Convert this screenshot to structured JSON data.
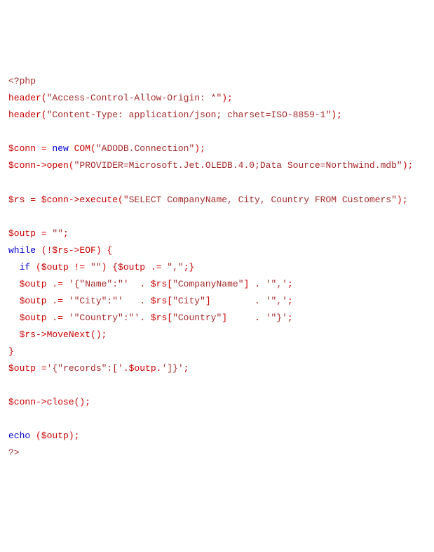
{
  "code": {
    "lines": [
      [
        {
          "text": "<?php",
          "cls": "brown"
        }
      ],
      [
        {
          "text": "header(",
          "cls": "red"
        },
        {
          "text": "\"Access-Control-Allow-Origin: *\"",
          "cls": "brown"
        },
        {
          "text": ");",
          "cls": "red"
        }
      ],
      [
        {
          "text": "header(",
          "cls": "red"
        },
        {
          "text": "\"Content-Type: application/json; charset=ISO-8859-1\"",
          "cls": "brown"
        },
        {
          "text": ");",
          "cls": "red"
        }
      ],
      [
        {
          "text": "",
          "cls": "black"
        }
      ],
      [
        {
          "text": "$conn = ",
          "cls": "red"
        },
        {
          "text": "new",
          "cls": "blue"
        },
        {
          "text": " COM(",
          "cls": "red"
        },
        {
          "text": "\"ADODB.Connection\"",
          "cls": "brown"
        },
        {
          "text": ");",
          "cls": "red"
        }
      ],
      [
        {
          "text": "$conn->open(",
          "cls": "red"
        },
        {
          "text": "\"PROVIDER=Microsoft.Jet.OLEDB.4.0;Data Source=Northwind.mdb\"",
          "cls": "brown"
        },
        {
          "text": ");",
          "cls": "red"
        }
      ],
      [
        {
          "text": "",
          "cls": "black"
        }
      ],
      [
        {
          "text": "$rs = $conn->execute(",
          "cls": "red"
        },
        {
          "text": "\"SELECT CompanyName, City, Country FROM Customers\"",
          "cls": "brown"
        },
        {
          "text": ");",
          "cls": "red"
        }
      ],
      [
        {
          "text": "",
          "cls": "black"
        }
      ],
      [
        {
          "text": "$outp = ",
          "cls": "red"
        },
        {
          "text": "\"\"",
          "cls": "brown"
        },
        {
          "text": ";",
          "cls": "red"
        }
      ],
      [
        {
          "text": "while",
          "cls": "blue"
        },
        {
          "text": " (!$rs->EOF) {",
          "cls": "red"
        }
      ],
      [
        {
          "text": "  ",
          "cls": "black"
        },
        {
          "text": "if",
          "cls": "blue"
        },
        {
          "text": " ($outp != ",
          "cls": "red"
        },
        {
          "text": "\"\"",
          "cls": "brown"
        },
        {
          "text": ") {$outp .= ",
          "cls": "red"
        },
        {
          "text": "\",\"",
          "cls": "brown"
        },
        {
          "text": ";}",
          "cls": "red"
        }
      ],
      [
        {
          "text": "  $outp .= ",
          "cls": "red"
        },
        {
          "text": "'{\"Name\":\"'",
          "cls": "brown"
        },
        {
          "text": "  . $rs[",
          "cls": "red"
        },
        {
          "text": "\"CompanyName\"",
          "cls": "brown"
        },
        {
          "text": "] . ",
          "cls": "red"
        },
        {
          "text": "'\",'",
          "cls": "brown"
        },
        {
          "text": ";",
          "cls": "red"
        }
      ],
      [
        {
          "text": "  $outp .= ",
          "cls": "red"
        },
        {
          "text": "'\"City\":\"'",
          "cls": "brown"
        },
        {
          "text": "   . $rs[",
          "cls": "red"
        },
        {
          "text": "\"City\"",
          "cls": "brown"
        },
        {
          "text": "]        . ",
          "cls": "red"
        },
        {
          "text": "'\",'",
          "cls": "brown"
        },
        {
          "text": ";",
          "cls": "red"
        }
      ],
      [
        {
          "text": "  $outp .= ",
          "cls": "red"
        },
        {
          "text": "'\"Country\":\"'",
          "cls": "brown"
        },
        {
          "text": ". $rs[",
          "cls": "red"
        },
        {
          "text": "\"Country\"",
          "cls": "brown"
        },
        {
          "text": "]     . ",
          "cls": "red"
        },
        {
          "text": "'\"}'",
          "cls": "brown"
        },
        {
          "text": ";",
          "cls": "red"
        }
      ],
      [
        {
          "text": "  $rs->MoveNext();",
          "cls": "red"
        }
      ],
      [
        {
          "text": "}",
          "cls": "red"
        }
      ],
      [
        {
          "text": "$outp =",
          "cls": "red"
        },
        {
          "text": "'{\"records\":['",
          "cls": "brown"
        },
        {
          "text": ".$outp.",
          "cls": "red"
        },
        {
          "text": "']}'",
          "cls": "brown"
        },
        {
          "text": ";",
          "cls": "red"
        }
      ],
      [
        {
          "text": "",
          "cls": "black"
        }
      ],
      [
        {
          "text": "$conn->close();",
          "cls": "red"
        }
      ],
      [
        {
          "text": "",
          "cls": "black"
        }
      ],
      [
        {
          "text": "echo",
          "cls": "blue"
        },
        {
          "text": " ($outp);",
          "cls": "red"
        }
      ],
      [
        {
          "text": "?>",
          "cls": "brown"
        }
      ]
    ]
  }
}
